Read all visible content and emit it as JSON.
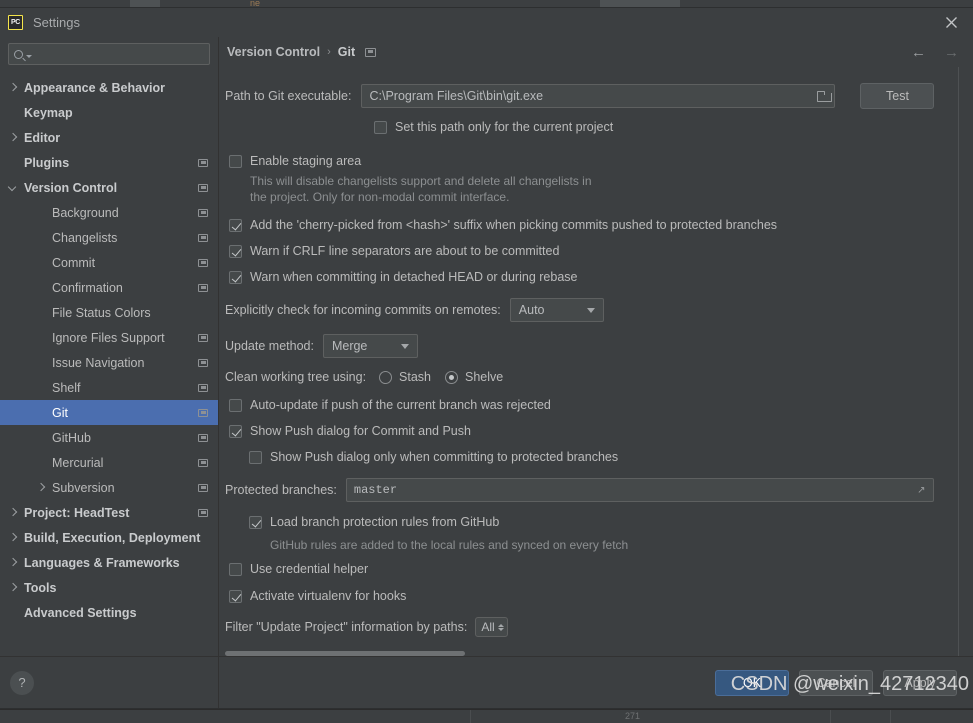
{
  "window": {
    "title": "Settings",
    "app_icon_text": "PC",
    "close_icon": "close-icon"
  },
  "sidebar": {
    "search": {
      "value": "",
      "placeholder": ""
    },
    "help_label": "?",
    "items": [
      {
        "label": "Appearance & Behavior",
        "indent": 0,
        "arrow": "right",
        "bold": true,
        "project_icon": false,
        "selected": false
      },
      {
        "label": "Keymap",
        "indent": 0,
        "arrow": "none",
        "bold": true,
        "project_icon": false,
        "selected": false
      },
      {
        "label": "Editor",
        "indent": 0,
        "arrow": "right",
        "bold": true,
        "project_icon": false,
        "selected": false
      },
      {
        "label": "Plugins",
        "indent": 0,
        "arrow": "none",
        "bold": true,
        "project_icon": true,
        "selected": false
      },
      {
        "label": "Version Control",
        "indent": 0,
        "arrow": "down",
        "bold": true,
        "project_icon": true,
        "selected": false
      },
      {
        "label": "Background",
        "indent": 1,
        "arrow": "none",
        "bold": false,
        "project_icon": true,
        "selected": false
      },
      {
        "label": "Changelists",
        "indent": 1,
        "arrow": "none",
        "bold": false,
        "project_icon": true,
        "selected": false
      },
      {
        "label": "Commit",
        "indent": 1,
        "arrow": "none",
        "bold": false,
        "project_icon": true,
        "selected": false
      },
      {
        "label": "Confirmation",
        "indent": 1,
        "arrow": "none",
        "bold": false,
        "project_icon": true,
        "selected": false
      },
      {
        "label": "File Status Colors",
        "indent": 1,
        "arrow": "none",
        "bold": false,
        "project_icon": false,
        "selected": false
      },
      {
        "label": "Ignore Files Support",
        "indent": 1,
        "arrow": "none",
        "bold": false,
        "project_icon": true,
        "selected": false
      },
      {
        "label": "Issue Navigation",
        "indent": 1,
        "arrow": "none",
        "bold": false,
        "project_icon": true,
        "selected": false
      },
      {
        "label": "Shelf",
        "indent": 1,
        "arrow": "none",
        "bold": false,
        "project_icon": true,
        "selected": false
      },
      {
        "label": "Git",
        "indent": 1,
        "arrow": "none",
        "bold": false,
        "project_icon": true,
        "selected": true
      },
      {
        "label": "GitHub",
        "indent": 1,
        "arrow": "none",
        "bold": false,
        "project_icon": true,
        "selected": false
      },
      {
        "label": "Mercurial",
        "indent": 1,
        "arrow": "none",
        "bold": false,
        "project_icon": true,
        "selected": false
      },
      {
        "label": "Subversion",
        "indent": 1,
        "arrow": "right",
        "bold": false,
        "project_icon": true,
        "selected": false
      },
      {
        "label": "Project: HeadTest",
        "indent": 0,
        "arrow": "right",
        "bold": true,
        "project_icon": true,
        "selected": false
      },
      {
        "label": "Build, Execution, Deployment",
        "indent": 0,
        "arrow": "right",
        "bold": true,
        "project_icon": false,
        "selected": false
      },
      {
        "label": "Languages & Frameworks",
        "indent": 0,
        "arrow": "right",
        "bold": true,
        "project_icon": false,
        "selected": false
      },
      {
        "label": "Tools",
        "indent": 0,
        "arrow": "right",
        "bold": true,
        "project_icon": false,
        "selected": false
      },
      {
        "label": "Advanced Settings",
        "indent": 0,
        "arrow": "none",
        "bold": true,
        "project_icon": false,
        "selected": false
      }
    ]
  },
  "breadcrumb": {
    "parent": "Version Control",
    "separator": "›",
    "current": "Git",
    "back_arrow": "←",
    "forward_arrow": "→"
  },
  "main": {
    "git_path": {
      "label": "Path to Git executable:",
      "value": "C:\\Program Files\\Git\\bin\\git.exe",
      "browse_icon": "folder-icon",
      "test_button": "Test"
    },
    "set_path_project_only": {
      "label": "Set this path only for the current project",
      "checked": false
    },
    "enable_staging_area": {
      "label": "Enable staging area",
      "checked": false,
      "hint_line1": "This will disable changelists support and delete all changelists in",
      "hint_line2": "the project. Only for non-modal commit interface."
    },
    "cherry_picked_suffix": {
      "label": "Add the 'cherry-picked from <hash>' suffix when picking commits pushed to protected branches",
      "checked": true
    },
    "warn_crlf": {
      "label": "Warn if CRLF line separators are about to be committed",
      "checked": true
    },
    "warn_detached_head": {
      "label": "Warn when committing in detached HEAD or during rebase",
      "checked": true
    },
    "incoming_commits": {
      "label": "Explicitly check for incoming commits on remotes:",
      "value": "Auto"
    },
    "update_method": {
      "label": "Update method:",
      "value": "Merge"
    },
    "clean_working_tree": {
      "label": "Clean working tree using:",
      "option_stash": "Stash",
      "option_shelve": "Shelve",
      "selected": "Shelve"
    },
    "auto_update_rejected": {
      "label": "Auto-update if push of the current branch was rejected",
      "checked": false
    },
    "show_push_dialog": {
      "label": "Show Push dialog for Commit and Push",
      "checked": true
    },
    "show_push_dialog_protected": {
      "label": "Show Push dialog only when committing to protected branches",
      "checked": false
    },
    "protected_branches": {
      "label": "Protected branches:",
      "value": "master",
      "expand_icon": "expand-icon"
    },
    "load_github_rules": {
      "label": "Load branch protection rules from GitHub",
      "checked": true,
      "hint": "GitHub rules are added to the local rules and synced on every fetch"
    },
    "use_credential_helper": {
      "label": "Use credential helper",
      "checked": false
    },
    "activate_virtualenv": {
      "label": "Activate virtualenv for hooks",
      "checked": true
    },
    "filter_paths": {
      "label": "Filter \"Update Project\" information by paths:",
      "value": "All"
    }
  },
  "footer": {
    "ok": "OK",
    "cancel": "Cancel",
    "apply": "Apply",
    "watermark": "CSDN @weixin_42712340"
  },
  "background": {
    "tab_text": "ne",
    "status_number": "271"
  },
  "colors": {
    "window_bg": "#3c3f41",
    "selection_blue": "#4b6eaf",
    "primary_button": "#365880",
    "field_bg": "#45494a",
    "text": "#bbbbbb",
    "hint_text": "#8c8f91",
    "accent_yellow": "#f5e54b"
  }
}
